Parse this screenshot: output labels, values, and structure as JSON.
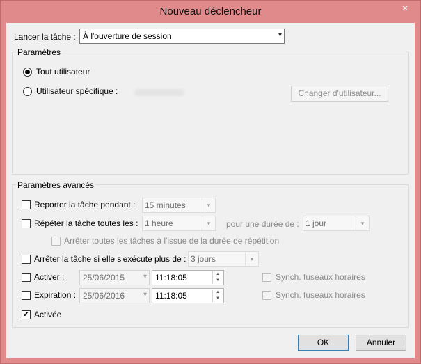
{
  "window": {
    "title": "Nouveau déclencheur",
    "close": "✕"
  },
  "launch": {
    "label": "Lancer la tâche :",
    "value": "À l'ouverture de session"
  },
  "params": {
    "group_title": "Paramètres",
    "any_user": "Tout utilisateur",
    "specific_user": "Utilisateur spécifique :",
    "change_user": "Changer d'utilisateur..."
  },
  "advanced": {
    "group_title": "Paramètres avancés",
    "delay_label": "Reporter la tâche pendant :",
    "delay_value": "15 minutes",
    "repeat_label": "Répéter la tâche toutes les :",
    "repeat_value": "1 heure",
    "duration_label": "pour une durée de :",
    "duration_value": "1 jour",
    "stop_all_label": "Arrêter toutes les tâches à l'issue de la durée de répétition",
    "stop_if_label": "Arrêter la tâche si elle s'exécute plus de :",
    "stop_if_value": "3 jours",
    "activate_label": "Activer :",
    "activate_date": "25/06/2015",
    "activate_time": "11:18:05",
    "sync_activate": "Synch. fuseaux horaires",
    "expire_label": "Expiration :",
    "expire_date": "25/06/2016",
    "expire_time": "11:18:05",
    "sync_expire": "Synch. fuseaux horaires",
    "enabled_label": "Activée",
    "enabled_check": "✔"
  },
  "buttons": {
    "ok": "OK",
    "cancel": "Annuler"
  },
  "icons": {
    "chevron": "▾",
    "spin_up": "▲",
    "spin_down": "▼"
  },
  "colors": {
    "frame": "#e08a8c",
    "client": "#f0f0f0",
    "default_button_border": "#3c7fb1"
  }
}
